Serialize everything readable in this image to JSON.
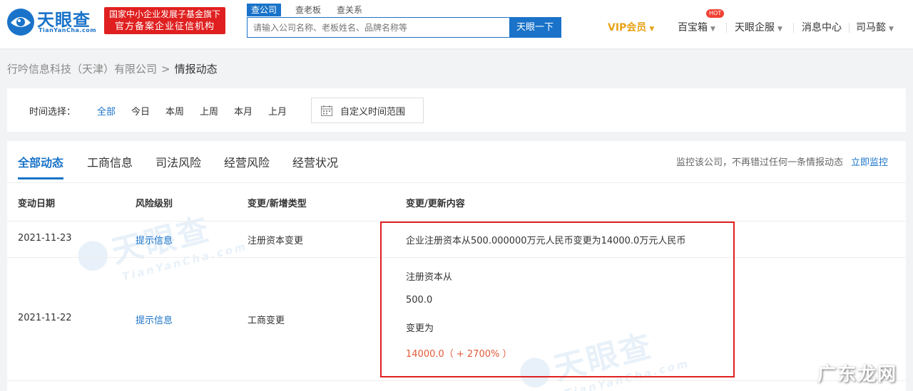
{
  "logo": {
    "name": "天眼查",
    "sub": "TianYanCha.com"
  },
  "badge": {
    "line1": "国家中小企业发展子基金旗下",
    "line2": "官方备案企业征信机构"
  },
  "search": {
    "tabs": [
      {
        "label": "查公司",
        "active": true
      },
      {
        "label": "查老板",
        "active": false
      },
      {
        "label": "查关系",
        "active": false
      }
    ],
    "placeholder": "请输入公司名称、老板姓名、品牌名称等",
    "button": "天眼一下"
  },
  "nav": {
    "vip": "VIP会员",
    "treasure": "百宝箱",
    "hot": "HOT",
    "enterprise": "天眼企服",
    "messages": "消息中心",
    "user": "司马懿"
  },
  "breadcrumb": {
    "company": "行吟信息科技（天津）有限公司",
    "sep": ">",
    "current": "情报动态"
  },
  "time_filter": {
    "label": "时间选择：",
    "options": [
      "全部",
      "今日",
      "本周",
      "上周",
      "本月",
      "上月"
    ],
    "active": "全部",
    "custom": "自定义时间范围"
  },
  "tabs": [
    "全部动态",
    "工商信息",
    "司法风险",
    "经营风险",
    "经营状况"
  ],
  "active_tab": "全部动态",
  "monitor": {
    "text": "监控该公司，不再错过任何一条情报动态",
    "link": "立即监控"
  },
  "table": {
    "headers": [
      "变动日期",
      "风险级别",
      "变更/新增类型",
      "变更/更新内容"
    ],
    "rows": [
      {
        "date": "2021-11-23",
        "risk": "提示信息",
        "type": "注册资本变更",
        "content": "企业注册资本从500.000000万元人民币变更为14000.0万元人民币"
      },
      {
        "date": "2021-11-22",
        "risk": "提示信息",
        "type": "工商变更",
        "lines": [
          "注册资本从",
          "500.0",
          "变更为"
        ],
        "new_value": "14000.0（ + 2700% ）"
      }
    ]
  },
  "watermark": {
    "cn": "天眼查",
    "en": "TianYanCha.com"
  },
  "corner": "广东龙网",
  "colors": {
    "brand_blue": "#1a73c9",
    "badge_red": "#e02020",
    "vip_gold": "#e8a318",
    "highlight_red": "#e02020"
  }
}
